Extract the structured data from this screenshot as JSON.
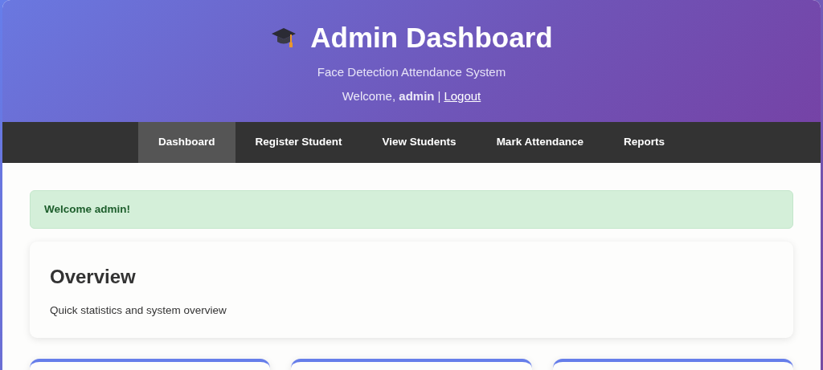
{
  "header": {
    "title": "Admin Dashboard",
    "subtitle": "Face Detection Attendance System",
    "welcome_prefix": "Welcome,",
    "username": "admin",
    "separator": "|",
    "logout": "Logout"
  },
  "nav": [
    {
      "label": "Dashboard",
      "selected": true
    },
    {
      "label": "Register Student",
      "selected": false
    },
    {
      "label": "View Students",
      "selected": false
    },
    {
      "label": "Mark Attendance",
      "selected": false
    },
    {
      "label": "Reports",
      "selected": false
    }
  ],
  "alert": {
    "kind": "success",
    "text": "Welcome admin!"
  },
  "overview": {
    "title": "Overview",
    "text": "Quick statistics and system overview"
  },
  "stat_cards": [
    {
      "kind": "card"
    },
    {
      "kind": "card"
    },
    {
      "kind": "card"
    }
  ]
}
